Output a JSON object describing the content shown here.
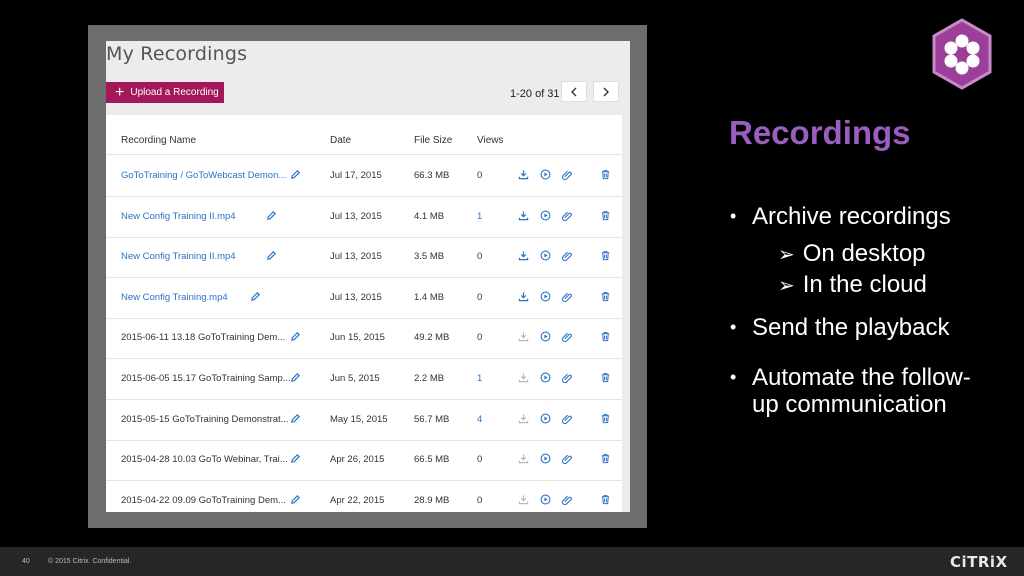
{
  "app": {
    "title": "My Recordings",
    "upload_label": "Upload a Recording",
    "pager_text": "1-20 of 31"
  },
  "columns": [
    "Recording Name",
    "Date",
    "File Size",
    "Views"
  ],
  "rows": [
    {
      "name": "GoToTraining / GoToWebcast Demon...",
      "date": "Jul 17, 2015",
      "size": "66.3 MB",
      "views": "0",
      "name_link": true,
      "views_link": false,
      "dl_active": true
    },
    {
      "name": "New Config Training II.mp4",
      "date": "Jul 13, 2015",
      "size": "4.1 MB",
      "views": "1",
      "name_link": true,
      "views_link": true,
      "dl_active": true
    },
    {
      "name": "New Config Training II.mp4",
      "date": "Jul 13, 2015",
      "size": "3.5 MB",
      "views": "0",
      "name_link": true,
      "views_link": false,
      "dl_active": true
    },
    {
      "name": "New Config Training.mp4",
      "date": "Jul 13, 2015",
      "size": "1.4 MB",
      "views": "0",
      "name_link": true,
      "views_link": false,
      "dl_active": true
    },
    {
      "name": "2015-06-11 13.18 GoToTraining Dem...",
      "date": "Jun 15, 2015",
      "size": "49.2 MB",
      "views": "0",
      "name_link": false,
      "views_link": false,
      "dl_active": false
    },
    {
      "name": "2015-06-05 15.17 GoToTraining Samp...",
      "date": "Jun 5, 2015",
      "size": "2.2 MB",
      "views": "1",
      "name_link": false,
      "views_link": true,
      "dl_active": false
    },
    {
      "name": "2015-05-15 GoToTraining Demonstrat...",
      "date": "May 15, 2015",
      "size": "56.7 MB",
      "views": "4",
      "name_link": false,
      "views_link": true,
      "dl_active": false
    },
    {
      "name": "2015-04-28 10.03 GoTo Webinar, Trai...",
      "date": "Apr 26, 2015",
      "size": "66.5 MB",
      "views": "0",
      "name_link": false,
      "views_link": false,
      "dl_active": false
    },
    {
      "name": "2015-04-22 09.09 GoToTraining Dem...",
      "date": "Apr 22, 2015",
      "size": "28.9 MB",
      "views": "0",
      "name_link": false,
      "views_link": false,
      "dl_active": false
    }
  ],
  "slide": {
    "heading": "Recordings",
    "bullet1": "Archive recordings",
    "sub1": "On desktop",
    "sub2": "In the cloud",
    "bullet2": "Send the playback",
    "bullet3_line1": "Automate the follow-",
    "bullet3_line2": "up communication",
    "bullet_char": "•",
    "arrow_char": "➢"
  },
  "footer": {
    "page_number": "40",
    "copyright": "© 2015 Citrix. Confidential.",
    "brand": "CiTRiX"
  },
  "colors": {
    "accent": "#a3185a",
    "link": "#2a73c5",
    "heading": "#9a5dc0",
    "logo": "#9b3f9a"
  }
}
